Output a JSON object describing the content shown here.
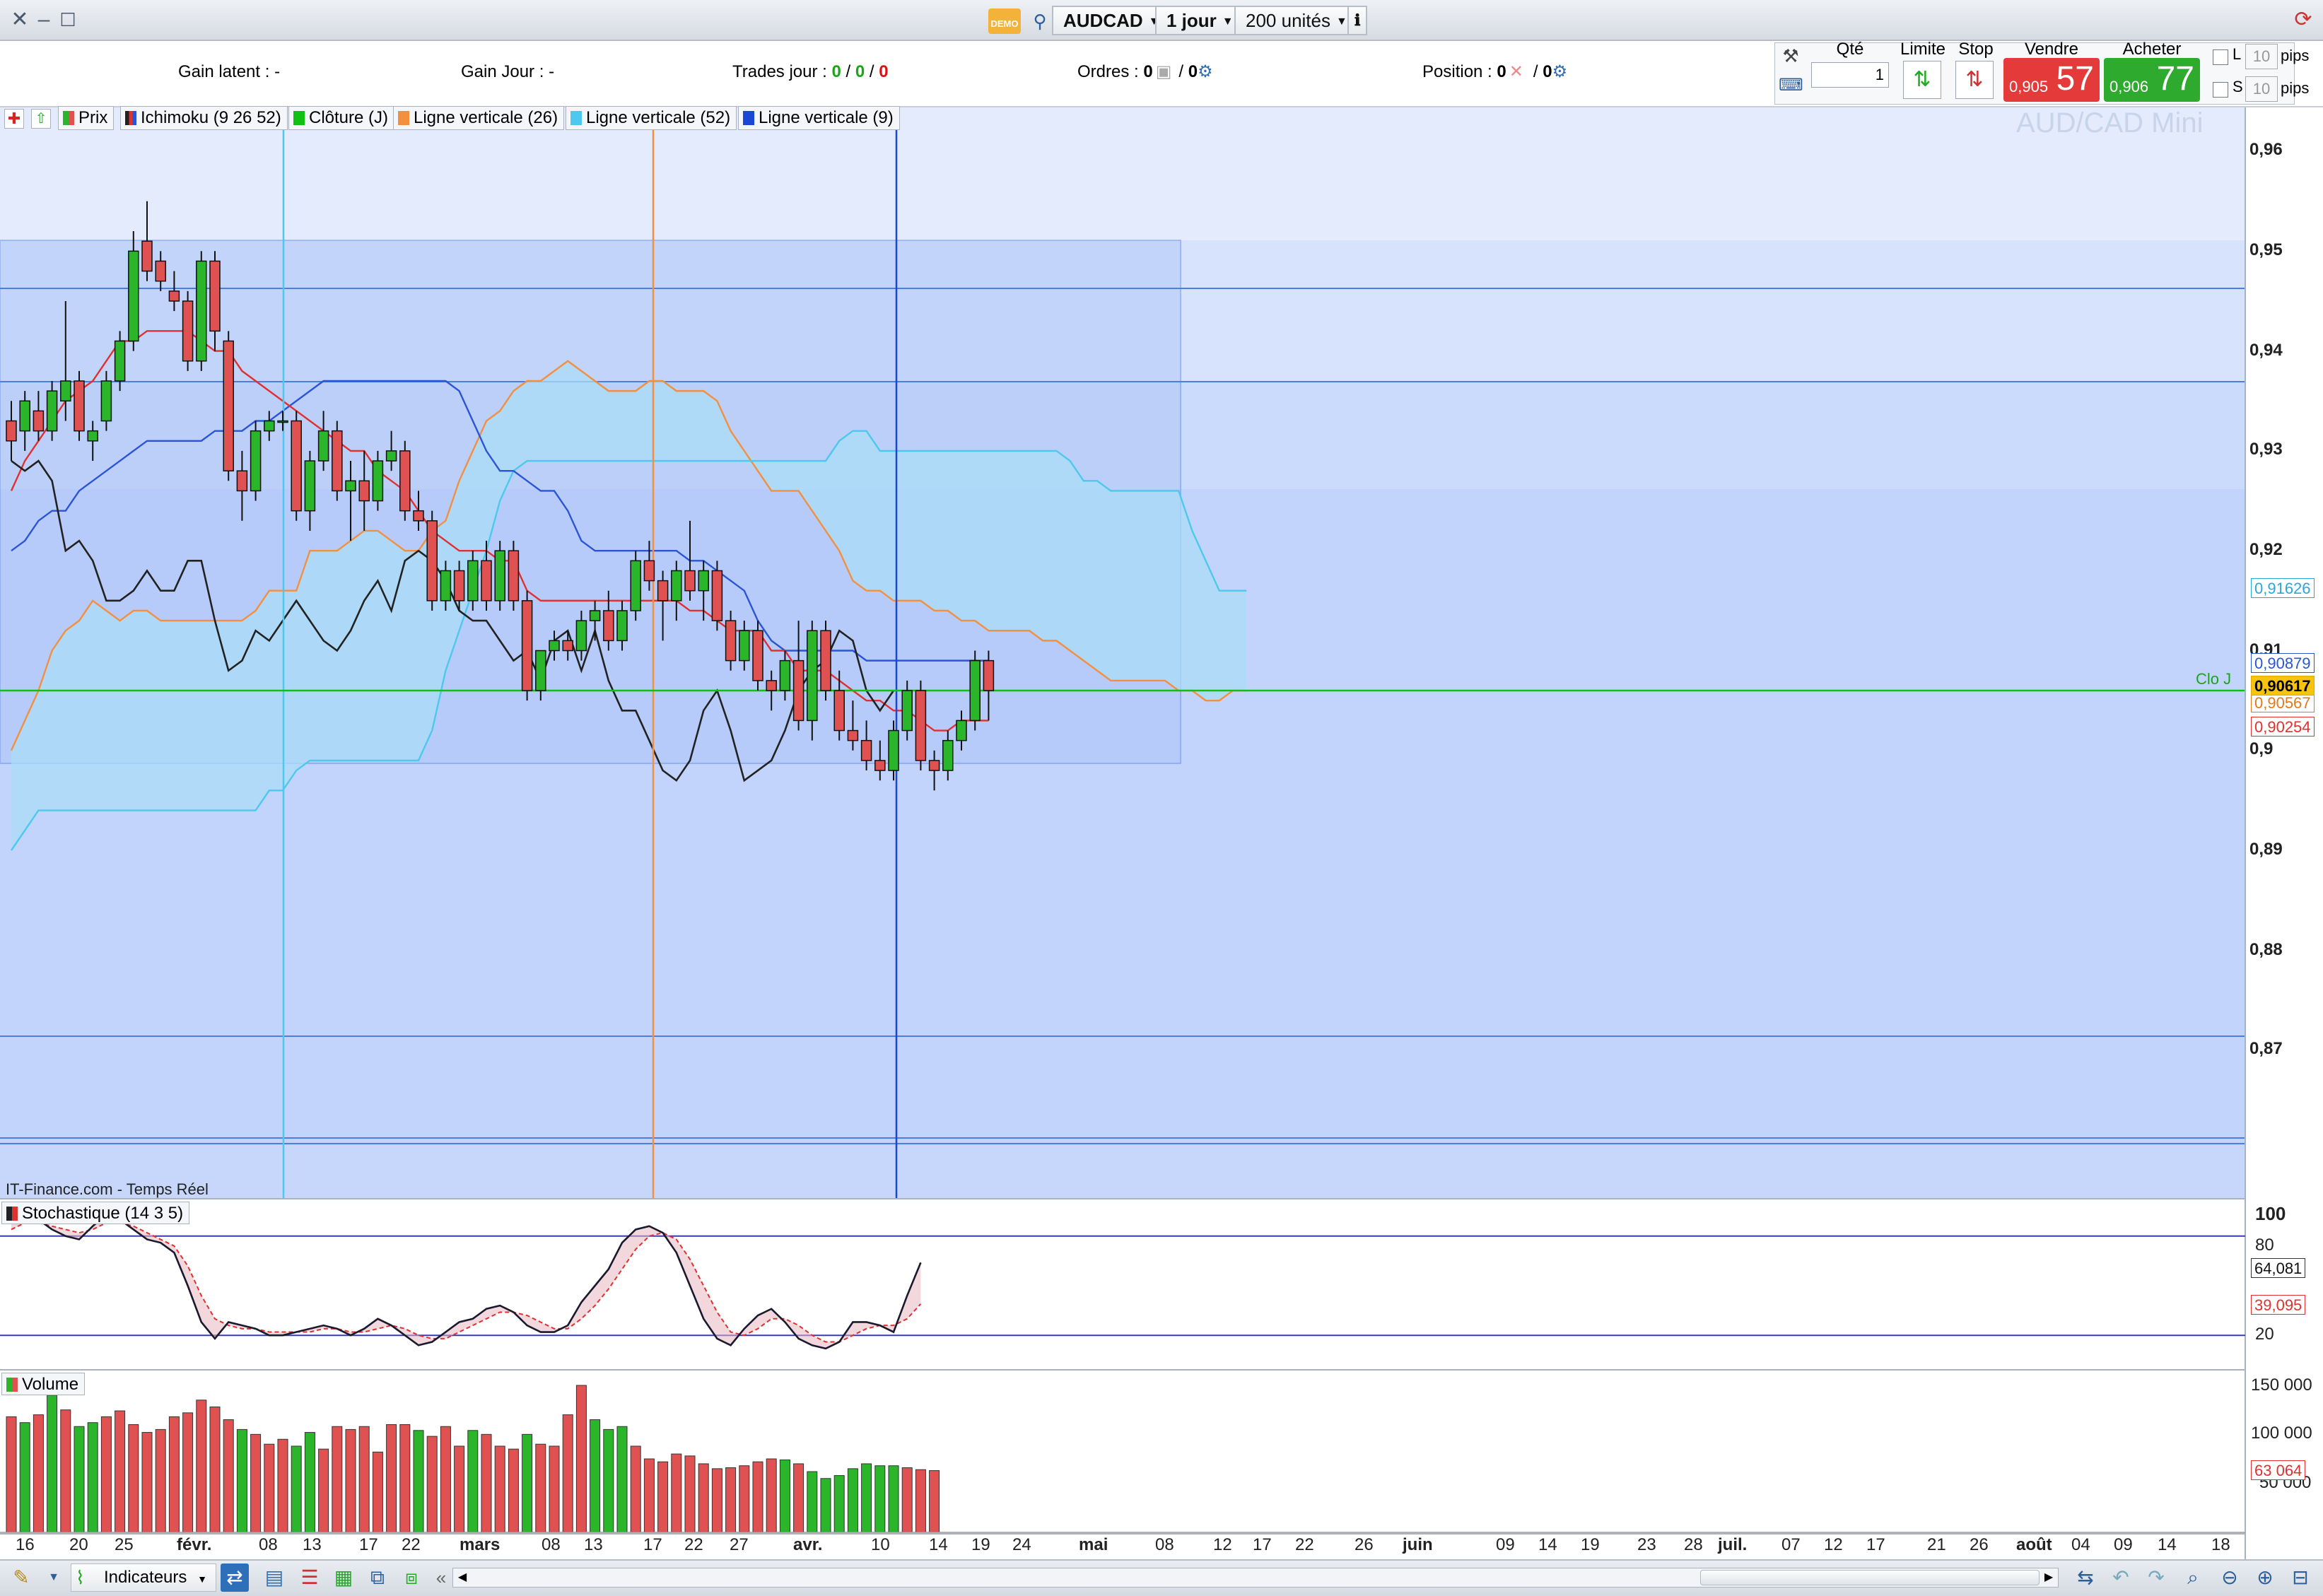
{
  "titlebar": {
    "symbol": "AUDCAD",
    "timeframe": "1 jour",
    "units": "200 unités",
    "demo_badge": "DEMO"
  },
  "infobar": {
    "gain_latent_label": "Gain latent :",
    "gain_latent_value": "-",
    "gain_jour_label": "Gain Jour :",
    "gain_jour_value": "-",
    "trades_label": "Trades jour :",
    "trades_v1": "0",
    "trades_v2": "0",
    "trades_v3": "0",
    "ordres_label": "Ordres :",
    "ordres_v1": "0",
    "ordres_v2": "0",
    "position_label": "Position :",
    "position_v1": "0",
    "position_v2": "0",
    "slash": "/"
  },
  "trade_panel": {
    "qty_label": "Qté",
    "qty_value": "1",
    "limit_label": "Limite",
    "stop_label": "Stop",
    "sell_label": "Vendre",
    "buy_label": "Acheter",
    "sell_small": "0,905",
    "sell_big": "57",
    "buy_small": "0,906",
    "buy_big": "77",
    "l_label": "L",
    "s_label": "S",
    "pips_value": "10",
    "pips_label": "pips"
  },
  "legend_main": {
    "prix": "Prix",
    "ichimoku": "Ichimoku (9 26 52)",
    "cloture": "Clôture (J)",
    "lv26": "Ligne verticale (26)",
    "lv52": "Ligne verticale (52)",
    "lv9": "Ligne verticale (9)"
  },
  "watermark": "AUD/CAD Mini",
  "source_label": "IT-Finance.com - Temps Réel",
  "clo_label": "Clo J",
  "price_tags": {
    "t1": "0,91626",
    "t2": "0,90879",
    "t3": "0,90617",
    "t4": "0,90567",
    "t5": "0,90254"
  },
  "stoch": {
    "legend": "Stochastique (14 3 5)",
    "lab100": "100",
    "lab80": "80",
    "lab20": "20",
    "tag_k": "64,081",
    "tag_d": "39,095",
    "values_k": [
      92,
      94,
      90,
      84,
      80,
      78,
      86,
      93,
      90,
      84,
      78,
      76,
      70,
      50,
      28,
      18,
      28,
      26,
      24,
      20,
      20,
      22,
      24,
      26,
      24,
      20,
      24,
      30,
      26,
      20,
      14,
      16,
      22,
      28,
      30,
      36,
      38,
      34,
      26,
      22,
      22,
      26,
      40,
      50,
      60,
      76,
      84,
      86,
      82,
      70,
      50,
      30,
      18,
      14,
      24,
      32,
      36,
      28,
      18,
      14,
      12,
      16,
      28,
      28,
      26,
      22,
      44,
      64
    ],
    "values_d": [
      84,
      88,
      88,
      86,
      84,
      82,
      84,
      88,
      88,
      86,
      82,
      78,
      74,
      62,
      44,
      30,
      26,
      24,
      24,
      22,
      22,
      22,
      22,
      24,
      24,
      22,
      22,
      24,
      26,
      24,
      20,
      18,
      18,
      22,
      26,
      30,
      34,
      34,
      32,
      28,
      24,
      24,
      30,
      38,
      48,
      60,
      72,
      80,
      82,
      78,
      66,
      50,
      34,
      22,
      20,
      24,
      30,
      30,
      26,
      20,
      16,
      16,
      20,
      24,
      26,
      26,
      30,
      39
    ]
  },
  "volume": {
    "legend": "Volume",
    "lab150": "150 000",
    "lab100": "100 000",
    "lab50": "50 000",
    "tag": "63 064",
    "values": [
      118000,
      112000,
      120000,
      140000,
      125000,
      108000,
      112000,
      118000,
      124000,
      110000,
      102000,
      105000,
      118000,
      122000,
      135000,
      128000,
      115000,
      105000,
      100000,
      90000,
      95000,
      88000,
      102000,
      85000,
      108000,
      105000,
      108000,
      82000,
      110000,
      110000,
      104000,
      98000,
      108000,
      88000,
      104000,
      100000,
      88000,
      85000,
      100000,
      90000,
      88000,
      120000,
      150000,
      115000,
      105000,
      108000,
      88000,
      75000,
      72000,
      80000,
      78000,
      70000,
      65000,
      66000,
      68000,
      72000,
      75000,
      74000,
      70000,
      62000,
      55000,
      58000,
      65000,
      70000,
      68000,
      68000,
      66000,
      64000,
      63064
    ],
    "colors": "rgrgrggrrrrrrrrrrgrrrggrrrrrrrgrrrgrrrgrrrrgggrrrrrrrrrrrgrgggggggr"
  },
  "y_axis": [
    "0,96",
    "0,95",
    "0,94",
    "0,93",
    "0,92",
    "0,91",
    "0,9",
    "0,89",
    "0,88",
    "0,87"
  ],
  "x_axis": [
    "16",
    "20",
    "25",
    "févr.",
    "08",
    "13",
    "17",
    "22",
    "mars",
    "08",
    "13",
    "17",
    "22",
    "27",
    "avr.",
    "10",
    "14",
    "19",
    "24",
    "mai",
    "08",
    "12",
    "17",
    "22",
    "26",
    "juin",
    "09",
    "14",
    "19",
    "23",
    "28",
    "juil.",
    "07",
    "12",
    "17",
    "21",
    "26",
    "août",
    "04",
    "09",
    "14",
    "18"
  ],
  "bottombar": {
    "indicators_label": "Indicateurs"
  },
  "chart_data": {
    "type": "candlestick",
    "symbol": "AUD/CAD Mini",
    "ylim": [
      0.86,
      0.965
    ],
    "candles": [
      [
        0.933,
        0.935,
        0.929,
        0.931
      ],
      [
        0.932,
        0.936,
        0.93,
        0.935
      ],
      [
        0.934,
        0.936,
        0.931,
        0.932
      ],
      [
        0.932,
        0.937,
        0.931,
        0.936
      ],
      [
        0.935,
        0.945,
        0.933,
        0.937
      ],
      [
        0.937,
        0.938,
        0.931,
        0.932
      ],
      [
        0.931,
        0.933,
        0.929,
        0.932
      ],
      [
        0.933,
        0.938,
        0.932,
        0.937
      ],
      [
        0.937,
        0.942,
        0.936,
        0.941
      ],
      [
        0.941,
        0.952,
        0.94,
        0.95
      ],
      [
        0.951,
        0.955,
        0.947,
        0.948
      ],
      [
        0.949,
        0.95,
        0.946,
        0.947
      ],
      [
        0.946,
        0.948,
        0.944,
        0.945
      ],
      [
        0.945,
        0.946,
        0.938,
        0.939
      ],
      [
        0.939,
        0.95,
        0.938,
        0.949
      ],
      [
        0.949,
        0.95,
        0.94,
        0.942
      ],
      [
        0.941,
        0.942,
        0.927,
        0.928
      ],
      [
        0.928,
        0.93,
        0.923,
        0.926
      ],
      [
        0.926,
        0.933,
        0.925,
        0.932
      ],
      [
        0.932,
        0.934,
        0.931,
        0.933
      ],
      [
        0.933,
        0.934,
        0.932,
        0.933
      ],
      [
        0.933,
        0.934,
        0.923,
        0.924
      ],
      [
        0.924,
        0.93,
        0.922,
        0.929
      ],
      [
        0.929,
        0.934,
        0.928,
        0.932
      ],
      [
        0.932,
        0.933,
        0.925,
        0.926
      ],
      [
        0.926,
        0.929,
        0.921,
        0.927
      ],
      [
        0.927,
        0.93,
        0.922,
        0.925
      ],
      [
        0.925,
        0.93,
        0.924,
        0.929
      ],
      [
        0.929,
        0.932,
        0.928,
        0.93
      ],
      [
        0.93,
        0.931,
        0.923,
        0.924
      ],
      [
        0.924,
        0.926,
        0.922,
        0.923
      ],
      [
        0.923,
        0.924,
        0.914,
        0.915
      ],
      [
        0.915,
        0.919,
        0.914,
        0.918
      ],
      [
        0.918,
        0.919,
        0.914,
        0.915
      ],
      [
        0.915,
        0.92,
        0.914,
        0.919
      ],
      [
        0.919,
        0.921,
        0.914,
        0.915
      ],
      [
        0.915,
        0.921,
        0.914,
        0.92
      ],
      [
        0.92,
        0.921,
        0.914,
        0.915
      ],
      [
        0.915,
        0.916,
        0.905,
        0.906
      ],
      [
        0.906,
        0.91,
        0.905,
        0.91
      ],
      [
        0.91,
        0.912,
        0.909,
        0.911
      ],
      [
        0.911,
        0.912,
        0.909,
        0.91
      ],
      [
        0.91,
        0.914,
        0.909,
        0.913
      ],
      [
        0.913,
        0.915,
        0.911,
        0.914
      ],
      [
        0.914,
        0.916,
        0.91,
        0.911
      ],
      [
        0.911,
        0.915,
        0.91,
        0.914
      ],
      [
        0.914,
        0.92,
        0.913,
        0.919
      ],
      [
        0.919,
        0.921,
        0.916,
        0.917
      ],
      [
        0.917,
        0.918,
        0.911,
        0.915
      ],
      [
        0.915,
        0.919,
        0.913,
        0.918
      ],
      [
        0.918,
        0.923,
        0.915,
        0.916
      ],
      [
        0.916,
        0.919,
        0.913,
        0.918
      ],
      [
        0.918,
        0.919,
        0.912,
        0.913
      ],
      [
        0.913,
        0.914,
        0.908,
        0.909
      ],
      [
        0.909,
        0.913,
        0.908,
        0.912
      ],
      [
        0.912,
        0.913,
        0.906,
        0.907
      ],
      [
        0.907,
        0.908,
        0.904,
        0.906
      ],
      [
        0.906,
        0.91,
        0.905,
        0.909
      ],
      [
        0.909,
        0.913,
        0.902,
        0.903
      ],
      [
        0.903,
        0.913,
        0.901,
        0.912
      ],
      [
        0.912,
        0.913,
        0.905,
        0.906
      ],
      [
        0.906,
        0.908,
        0.901,
        0.902
      ],
      [
        0.902,
        0.905,
        0.9,
        0.901
      ],
      [
        0.901,
        0.903,
        0.898,
        0.899
      ],
      [
        0.899,
        0.901,
        0.897,
        0.898
      ],
      [
        0.898,
        0.903,
        0.897,
        0.902
      ],
      [
        0.902,
        0.907,
        0.901,
        0.906
      ],
      [
        0.906,
        0.907,
        0.898,
        0.899
      ],
      [
        0.899,
        0.9,
        0.896,
        0.898
      ],
      [
        0.898,
        0.902,
        0.897,
        0.901
      ],
      [
        0.901,
        0.904,
        0.9,
        0.903
      ],
      [
        0.903,
        0.91,
        0.902,
        0.909
      ],
      [
        0.909,
        0.91,
        0.903,
        0.906
      ]
    ],
    "tenkan": [
      0.926,
      0.929,
      0.931,
      0.933,
      0.935,
      0.936,
      0.937,
      0.939,
      0.941,
      0.941,
      0.942,
      0.942,
      0.942,
      0.942,
      0.941,
      0.94,
      0.94,
      0.938,
      0.937,
      0.936,
      0.935,
      0.934,
      0.933,
      0.932,
      0.931,
      0.93,
      0.93,
      0.928,
      0.927,
      0.926,
      0.924,
      0.922,
      0.921,
      0.92,
      0.92,
      0.92,
      0.919,
      0.919,
      0.916,
      0.915,
      0.915,
      0.915,
      0.915,
      0.915,
      0.915,
      0.915,
      0.915,
      0.915,
      0.915,
      0.915,
      0.914,
      0.914,
      0.913,
      0.912,
      0.912,
      0.912,
      0.91,
      0.91,
      0.908,
      0.908,
      0.908,
      0.907,
      0.906,
      0.905,
      0.905,
      0.904,
      0.904,
      0.903,
      0.902,
      0.902,
      0.903,
      0.903,
      0.903
    ],
    "kijun": [
      0.92,
      0.921,
      0.923,
      0.924,
      0.924,
      0.926,
      0.927,
      0.928,
      0.929,
      0.93,
      0.931,
      0.931,
      0.931,
      0.931,
      0.931,
      0.932,
      0.932,
      0.932,
      0.933,
      0.933,
      0.934,
      0.935,
      0.936,
      0.937,
      0.937,
      0.937,
      0.937,
      0.937,
      0.937,
      0.937,
      0.937,
      0.937,
      0.937,
      0.936,
      0.933,
      0.93,
      0.928,
      0.928,
      0.927,
      0.926,
      0.926,
      0.924,
      0.921,
      0.92,
      0.92,
      0.92,
      0.92,
      0.92,
      0.92,
      0.92,
      0.919,
      0.919,
      0.918,
      0.917,
      0.916,
      0.913,
      0.911,
      0.91,
      0.91,
      0.91,
      0.91,
      0.91,
      0.91,
      0.909,
      0.909,
      0.909,
      0.909,
      0.909,
      0.909,
      0.909,
      0.909,
      0.909,
      0.909
    ],
    "chikou": [
      0.929,
      0.928,
      0.929,
      0.927,
      0.92,
      0.921,
      0.919,
      0.915,
      0.915,
      0.916,
      0.918,
      0.916,
      0.916,
      0.919,
      0.919,
      0.913,
      0.908,
      0.909,
      0.912,
      0.911,
      0.913,
      0.915,
      0.913,
      0.911,
      0.91,
      0.912,
      0.915,
      0.917,
      0.914,
      0.919,
      0.92,
      0.919,
      0.917,
      0.914,
      0.913,
      0.913,
      0.911,
      0.909,
      0.91,
      0.907,
      0.911,
      0.912,
      0.908,
      0.912,
      0.907,
      0.904,
      0.904,
      0.901,
      0.898,
      0.897,
      0.899,
      0.904,
      0.906,
      0.902,
      0.897,
      0.898,
      0.899,
      0.902,
      0.906,
      0.908,
      0.909,
      0.912,
      0.911,
      0.906,
      0.904,
      0.906
    ],
    "senkou_a": [
      0.9,
      0.903,
      0.906,
      0.91,
      0.912,
      0.913,
      0.915,
      0.914,
      0.913,
      0.914,
      0.914,
      0.913,
      0.913,
      0.913,
      0.913,
      0.913,
      0.913,
      0.913,
      0.914,
      0.916,
      0.916,
      0.916,
      0.92,
      0.92,
      0.92,
      0.921,
      0.922,
      0.922,
      0.921,
      0.92,
      0.92,
      0.922,
      0.923,
      0.927,
      0.93,
      0.933,
      0.934,
      0.936,
      0.937,
      0.937,
      0.938,
      0.939,
      0.938,
      0.937,
      0.936,
      0.936,
      0.936,
      0.937,
      0.937,
      0.936,
      0.936,
      0.936,
      0.935,
      0.932,
      0.93,
      0.928,
      0.926,
      0.926,
      0.926,
      0.924,
      0.922,
      0.92,
      0.917,
      0.916,
      0.916,
      0.915,
      0.915,
      0.915,
      0.914,
      0.914,
      0.913,
      0.913,
      0.912,
      0.912,
      0.912,
      0.912,
      0.911,
      0.911,
      0.91,
      0.909,
      0.908,
      0.907,
      0.907,
      0.907,
      0.907,
      0.907,
      0.906,
      0.906,
      0.905,
      0.905,
      0.906,
      0.906
    ],
    "senkou_b": [
      0.89,
      0.892,
      0.894,
      0.894,
      0.894,
      0.894,
      0.894,
      0.894,
      0.894,
      0.894,
      0.894,
      0.894,
      0.894,
      0.894,
      0.894,
      0.894,
      0.894,
      0.894,
      0.894,
      0.896,
      0.896,
      0.898,
      0.899,
      0.899,
      0.899,
      0.899,
      0.899,
      0.899,
      0.899,
      0.899,
      0.899,
      0.902,
      0.908,
      0.912,
      0.916,
      0.92,
      0.925,
      0.928,
      0.929,
      0.929,
      0.929,
      0.929,
      0.929,
      0.929,
      0.929,
      0.929,
      0.929,
      0.929,
      0.929,
      0.929,
      0.929,
      0.929,
      0.929,
      0.929,
      0.929,
      0.929,
      0.929,
      0.929,
      0.929,
      0.929,
      0.929,
      0.931,
      0.932,
      0.932,
      0.93,
      0.93,
      0.93,
      0.93,
      0.93,
      0.93,
      0.93,
      0.93,
      0.93,
      0.93,
      0.93,
      0.93,
      0.93,
      0.93,
      0.929,
      0.927,
      0.927,
      0.926,
      0.926,
      0.926,
      0.926,
      0.926,
      0.926,
      0.922,
      0.919,
      0.916,
      0.916,
      0.916
    ]
  }
}
